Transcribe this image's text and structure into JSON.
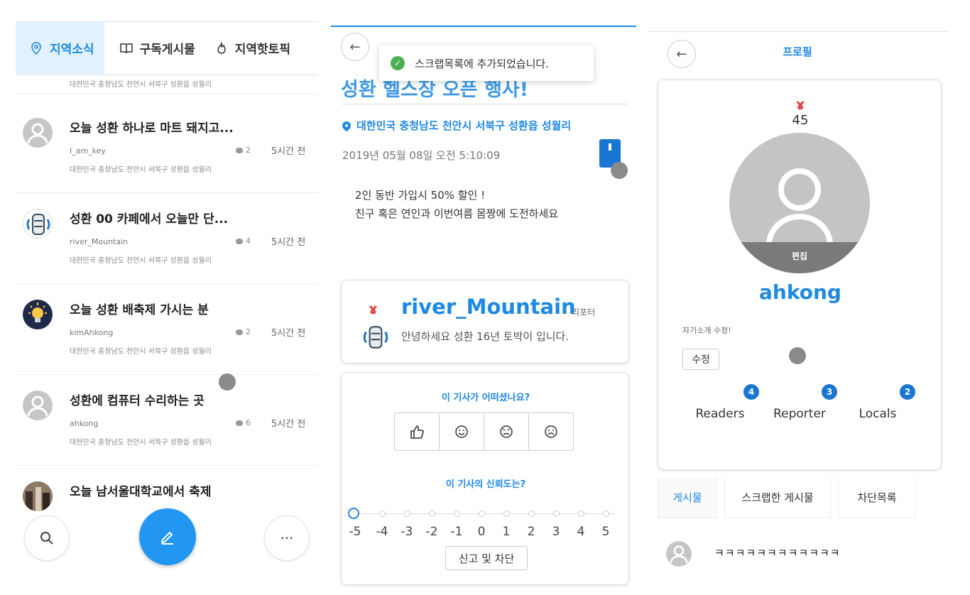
{
  "feed": {
    "tabs": [
      {
        "label": "지역소식",
        "icon": "location-pin-icon",
        "active": true
      },
      {
        "label": "구독게시물",
        "icon": "book-icon",
        "active": false
      },
      {
        "label": "지역핫토픽",
        "icon": "flame-icon",
        "active": false
      }
    ],
    "top_partial_location": "대한민국 충청남도 천안시 서북구 성환읍 성월리",
    "items": [
      {
        "title": "오늘 성환 하나로 마트 돼지고...",
        "author": "I_am_key",
        "comments": "2",
        "time": "5시간 전",
        "location": "대한민국 충청남도 천안시 서북구 성환읍 성월리",
        "avatar": "default-user-avatar"
      },
      {
        "title": "성환 00 카페에서 오늘만 단...",
        "author": "river_Mountain",
        "comments": "4",
        "time": "5시간 전",
        "location": "대한민국 충청남도 천안시 서북구 성환읍 성월리",
        "avatar": "character-avatar"
      },
      {
        "title": "오늘 성환 배축제 가시는 분",
        "author": "kimAhkong",
        "comments": "2",
        "time": "5시간 전",
        "location": "대한민국 충청남도 천안시 서북구 성환읍 성월리",
        "avatar": "lightbulb-avatar"
      },
      {
        "title": "성환에 컴퓨터 수리하는 곳",
        "author": "ahkong",
        "comments": "6",
        "time": "5시간 전",
        "location": "대한민국 충청남도 천안시 서북구 성환읍 성월리",
        "avatar": "default-user-avatar"
      },
      {
        "title": "오늘 남서울대학교에서 축제",
        "avatar": "photo-avatar"
      }
    ],
    "bottom": {
      "search_icon": "search-icon",
      "write_icon": "pencil-icon",
      "more_label": "···"
    }
  },
  "article": {
    "toast": "스크랩목록에 추가되었습니다.",
    "title": "성환 헬스장 오픈 행사!",
    "location": "대한민국 충청남도 천안시 서북구 성환읍 성월리",
    "date": "2019년 05월 08일 오전 5:10:09",
    "body": [
      "2인 동반 가입시 50% 할인 !",
      "친구 혹은 연인과 이번여름 몸짱에 도전하세요"
    ],
    "reporter": {
      "badge": "ɤ",
      "name": "river_Mountain",
      "role": "리포터",
      "intro": "안녕하세요 성환 16년 토박이 입니다."
    },
    "rating_question": "이 기사가 어떠셨나요?",
    "reactions": [
      "thumbs-up-icon",
      "smile-icon",
      "angry-icon",
      "sad-icon"
    ],
    "trust_question": "이 기사의 신뢰도는?",
    "trust_scale": [
      "-5",
      "-4",
      "-3",
      "-2",
      "-1",
      "0",
      "1",
      "2",
      "3",
      "4",
      "5"
    ],
    "trust_selected": "-5",
    "report_label": "신고 및 차단"
  },
  "profile": {
    "title": "프로필",
    "level_badge": "ɤ",
    "level": "45",
    "edit_photo": "편집",
    "username": "ahkong",
    "intro_label": "자기소개 수정!",
    "edit_label": "수정",
    "stats": [
      {
        "label": "Readers",
        "count": "4"
      },
      {
        "label": "Reporter",
        "count": "3"
      },
      {
        "label": "Locals",
        "count": "2"
      }
    ],
    "tabs": [
      {
        "label": "게시물",
        "active": true
      },
      {
        "label": "스크랩한 게시물",
        "active": false
      },
      {
        "label": "차단목록",
        "active": false
      }
    ],
    "first_post": "ㅋㅋㅋㅋㅋㅋㅋㅋㅋㅋㅋㅋ",
    "accent": "#1e88e5"
  }
}
